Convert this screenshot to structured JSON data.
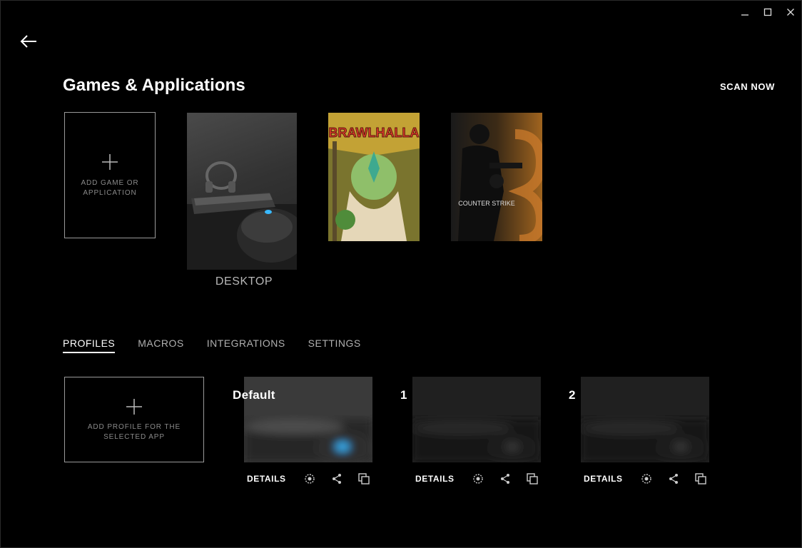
{
  "header": {
    "title": "Games & Applications",
    "scan_now": "SCAN NOW"
  },
  "window_controls": [
    "minimize-icon",
    "maximize-icon",
    "close-icon"
  ],
  "games": {
    "add_label": "ADD GAME OR APPLICATION",
    "items": [
      {
        "label": "DESKTOP",
        "art": "desktop-mouse-keyboard-image"
      },
      {
        "label": "",
        "art": "brawlhalla-cover-image",
        "cover_text": "BRAWLHALLA"
      },
      {
        "label": "",
        "art": "counter-strike-cover-image",
        "cover_text": "COUNTER STRIKE"
      }
    ]
  },
  "tabs": [
    {
      "label": "PROFILES",
      "active": true
    },
    {
      "label": "MACROS",
      "active": false
    },
    {
      "label": "INTEGRATIONS",
      "active": false
    },
    {
      "label": "SETTINGS",
      "active": false
    }
  ],
  "profiles": {
    "add_label": "ADD PROFILE FOR THE SELECTED APP",
    "items": [
      {
        "name": "Default",
        "details": "DETAILS"
      },
      {
        "name": "1",
        "details": "DETAILS"
      },
      {
        "name": "2",
        "details": "DETAILS"
      }
    ]
  },
  "colors": {
    "background": "#000000",
    "accent_led": "#39b9ff",
    "muted_text": "#8a8a8a"
  }
}
